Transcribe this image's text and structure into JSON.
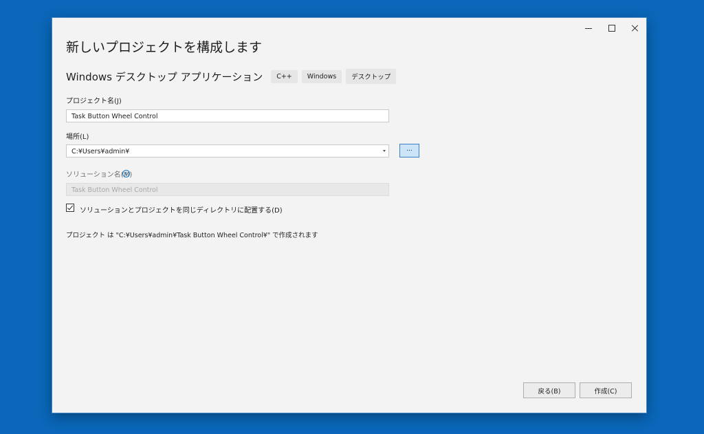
{
  "window": {
    "controls": {
      "minimize_icon": "minimize-icon",
      "maximize_icon": "maximize-icon",
      "close_icon": "close-icon"
    }
  },
  "header": {
    "title": "新しいプロジェクトを構成します",
    "template_name": "Windows デスクトップ アプリケーション",
    "tags": [
      "C++",
      "Windows",
      "デスクトップ"
    ]
  },
  "form": {
    "project_name": {
      "label": "プロジェクト名(J)",
      "value": "Task Button Wheel Control"
    },
    "location": {
      "label": "場所(L)",
      "value": "C:¥Users¥admin¥",
      "browse_label": "..."
    },
    "solution_name": {
      "label": "ソリューション名(M)",
      "value": "Task Button Wheel Control",
      "info_glyph": "i"
    },
    "same_directory": {
      "label": "ソリューションとプロジェクトを同じディレクトリに配置する(D)",
      "checked": true
    },
    "path_info": "プロジェクト は \"C:¥Users¥admin¥Task Button Wheel Control¥\" で作成されます"
  },
  "footer": {
    "back_label": "戻る(B)",
    "create_label": "作成(C)"
  },
  "colors": {
    "desktop": "#0a67b9",
    "dialog_bg": "#f3f3f3",
    "accent": "#1a78c2",
    "browse_bg": "#cce4f7"
  }
}
